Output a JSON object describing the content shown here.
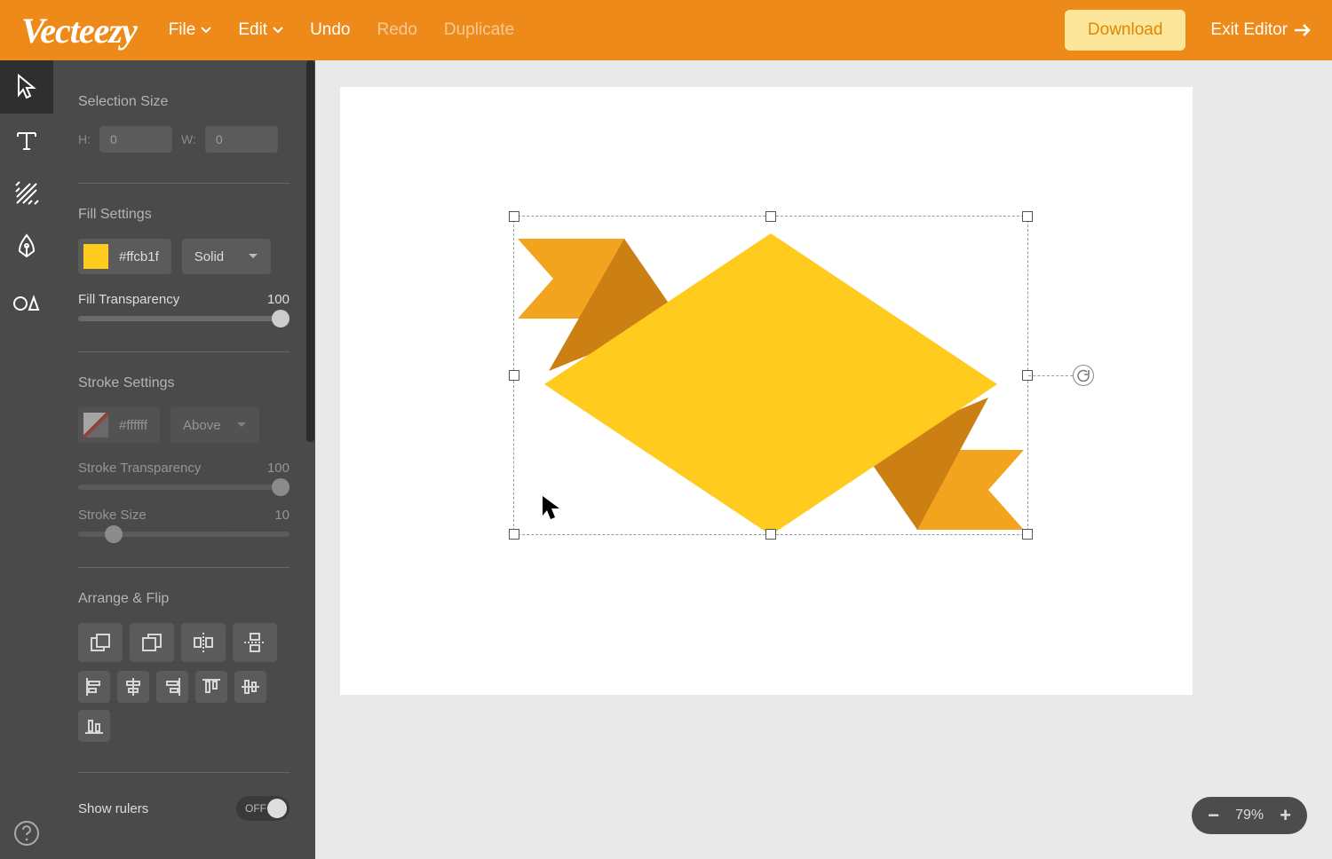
{
  "colors": {
    "headerBg": "#ED8A19",
    "downloadBg": "#FCE69B",
    "downloadFg": "#E08700",
    "fillSwatch": "#ffcb1f",
    "shapeMid": "#f3a41f",
    "shapeDark": "#cc7f13"
  },
  "header": {
    "logo": "Vecteezy",
    "menu": {
      "file": "File",
      "edit": "Edit",
      "undo": "Undo",
      "redo": "Redo",
      "duplicate": "Duplicate"
    },
    "download": "Download",
    "exit": "Exit Editor"
  },
  "panel": {
    "selection": {
      "title": "Selection Size",
      "hLabel": "H:",
      "h": "0",
      "wLabel": "W:",
      "w": "0"
    },
    "fill": {
      "title": "Fill Settings",
      "hex": "#ffcb1f",
      "mode": "Solid",
      "transparencyLabel": "Fill Transparency",
      "transparency": "100"
    },
    "stroke": {
      "title": "Stroke Settings",
      "hex": "#ffffff",
      "position": "Above",
      "transparencyLabel": "Stroke Transparency",
      "transparency": "100",
      "sizeLabel": "Stroke Size",
      "size": "10"
    },
    "arrange": {
      "title": "Arrange & Flip"
    },
    "rulers": {
      "label": "Show rulers",
      "state": "OFF"
    }
  },
  "zoom": {
    "value": "79%"
  }
}
